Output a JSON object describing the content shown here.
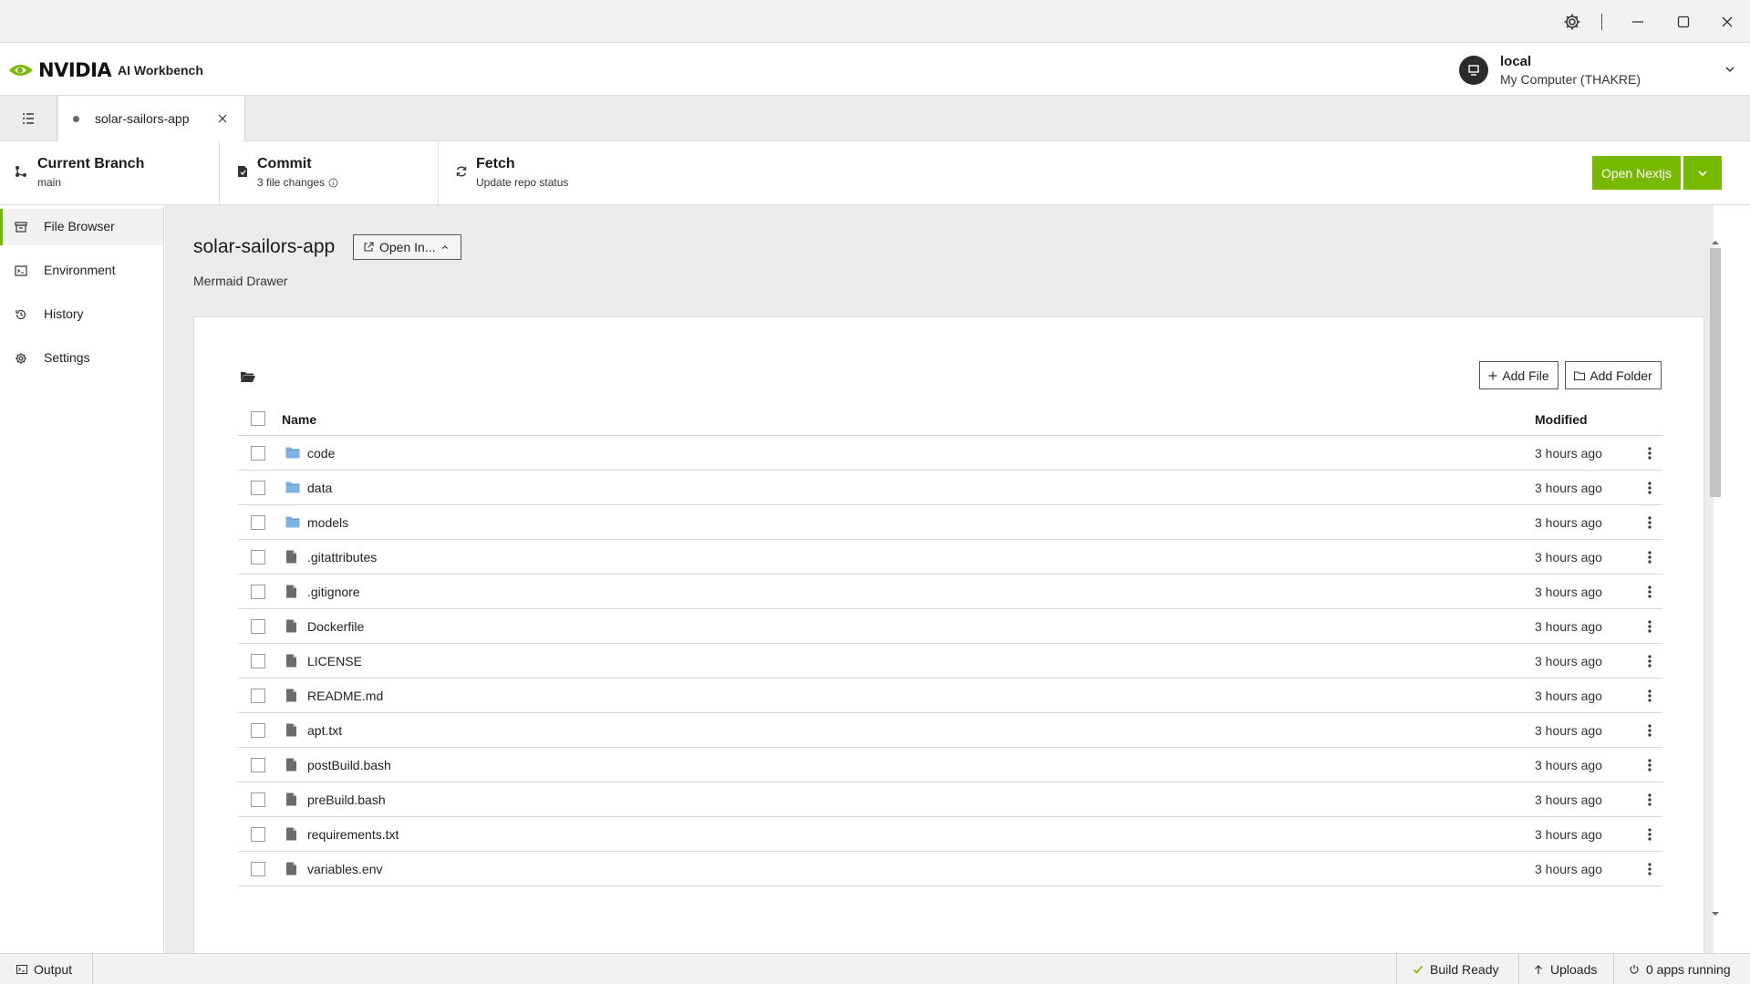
{
  "window": {
    "controls": [
      "gear-icon",
      "minimize-icon",
      "maximize-icon",
      "close-icon"
    ]
  },
  "header": {
    "brand": "NVIDIA",
    "app_name": "AI Workbench",
    "context": {
      "title": "local",
      "subtitle": "My Computer (THAKRE)"
    }
  },
  "tabs": [
    {
      "label": "solar-sailors-app",
      "active": true
    }
  ],
  "git": {
    "branch": {
      "title": "Current Branch",
      "sub": "main"
    },
    "commit": {
      "title": "Commit",
      "sub": "3 file changes"
    },
    "fetch": {
      "title": "Fetch",
      "sub": "Update repo status"
    },
    "open_button": "Open Nextjs"
  },
  "sidebar": {
    "items": [
      {
        "label": "File Browser",
        "icon": "archive-icon",
        "active": true
      },
      {
        "label": "Environment",
        "icon": "environment-icon",
        "active": false
      },
      {
        "label": "History",
        "icon": "history-icon",
        "active": false
      },
      {
        "label": "Settings",
        "icon": "gear-icon",
        "active": false
      }
    ]
  },
  "project": {
    "name": "solar-sailors-app",
    "open_in": "Open In...",
    "description": "Mermaid Drawer"
  },
  "file_browser": {
    "add_file": "Add File",
    "add_folder": "Add Folder",
    "columns": {
      "name": "Name",
      "modified": "Modified"
    },
    "rows": [
      {
        "name": "code",
        "type": "folder",
        "modified": "3 hours ago"
      },
      {
        "name": "data",
        "type": "folder",
        "modified": "3 hours ago"
      },
      {
        "name": "models",
        "type": "folder",
        "modified": "3 hours ago"
      },
      {
        "name": ".gitattributes",
        "type": "file",
        "modified": "3 hours ago"
      },
      {
        "name": ".gitignore",
        "type": "file",
        "modified": "3 hours ago"
      },
      {
        "name": "Dockerfile",
        "type": "file",
        "modified": "3 hours ago"
      },
      {
        "name": "LICENSE",
        "type": "file",
        "modified": "3 hours ago"
      },
      {
        "name": "README.md",
        "type": "file",
        "modified": "3 hours ago"
      },
      {
        "name": "apt.txt",
        "type": "file",
        "modified": "3 hours ago"
      },
      {
        "name": "postBuild.bash",
        "type": "file",
        "modified": "3 hours ago"
      },
      {
        "name": "preBuild.bash",
        "type": "file",
        "modified": "3 hours ago"
      },
      {
        "name": "requirements.txt",
        "type": "file",
        "modified": "3 hours ago"
      },
      {
        "name": "variables.env",
        "type": "file",
        "modified": "3 hours ago"
      }
    ]
  },
  "statusbar": {
    "output": "Output",
    "build": "Build Ready",
    "uploads": "Uploads",
    "apps": "0 apps running"
  },
  "colors": {
    "accent": "#76b900",
    "folder": "#7fb3e6",
    "file": "#6b6b6b"
  }
}
